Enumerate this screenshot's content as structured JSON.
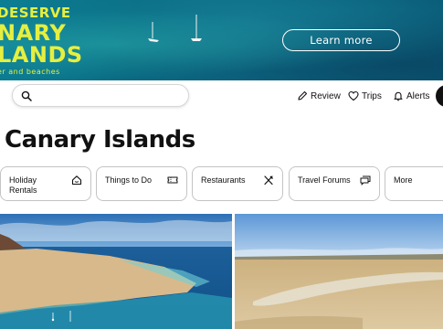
{
  "banner": {
    "line1": "DESERVE",
    "line2": "NARY",
    "line3": "LANDS",
    "line4": "er and beaches",
    "cta": "Learn more",
    "colors": {
      "headline": "#e6ef3f",
      "sea": "#0b7088"
    }
  },
  "nav": {
    "search_placeholder": "",
    "items": [
      {
        "label": "Review",
        "icon": "pencil-icon"
      },
      {
        "label": "Trips",
        "icon": "heart-icon"
      },
      {
        "label": "Alerts",
        "icon": "bell-icon"
      }
    ]
  },
  "page": {
    "title": "Canary Islands"
  },
  "categories": [
    {
      "label_line1": "Holiday",
      "label_line2": "Rentals",
      "icon": "house-icon"
    },
    {
      "label_line1": "Things to Do",
      "label_line2": "",
      "icon": "ticket-icon"
    },
    {
      "label_line1": "Restaurants",
      "label_line2": "",
      "icon": "fork-knife-icon"
    },
    {
      "label_line1": "Travel Forums",
      "label_line2": "",
      "icon": "chat-icon"
    },
    {
      "label_line1": "More",
      "label_line2": "",
      "icon": ""
    }
  ],
  "gallery": [
    {
      "name": "coastline-photo"
    },
    {
      "name": "beach-photo"
    }
  ]
}
